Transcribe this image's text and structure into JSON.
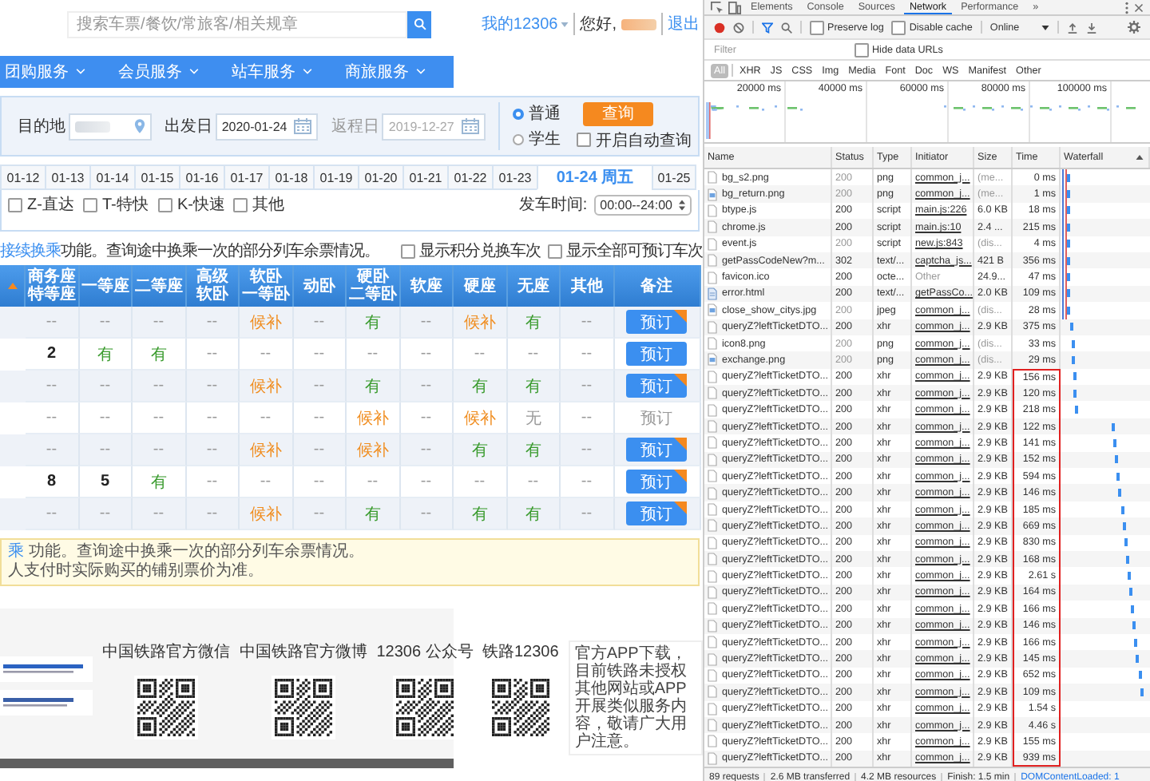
{
  "header": {
    "search_placeholder": "搜索车票/餐饮/常旅客/相关规章",
    "account_menu": "我的12306",
    "greeting": "您好,",
    "logout": "退出"
  },
  "nav": [
    {
      "label": "团购服务"
    },
    {
      "label": "会员服务"
    },
    {
      "label": "站车服务"
    },
    {
      "label": "商旅服务"
    }
  ],
  "search_form": {
    "destination_label": "目的地",
    "depart_label": "出发日",
    "depart_value": "2020-01-24",
    "return_label": "返程日",
    "return_value": "2019-12-27",
    "return_disabled": true,
    "ticket_types": [
      {
        "label": "普通",
        "selected": true
      },
      {
        "label": "学生",
        "selected": false
      }
    ],
    "query_button": "查询",
    "auto_query": {
      "label": "开启自动查询",
      "checked": false
    }
  },
  "date_tabs": [
    {
      "label": "01-12",
      "selected": false
    },
    {
      "label": "01-13",
      "selected": false
    },
    {
      "label": "01-14",
      "selected": false
    },
    {
      "label": "01-15",
      "selected": false
    },
    {
      "label": "01-16",
      "selected": false
    },
    {
      "label": "01-17",
      "selected": false
    },
    {
      "label": "01-18",
      "selected": false
    },
    {
      "label": "01-19",
      "selected": false
    },
    {
      "label": "01-20",
      "selected": false
    },
    {
      "label": "01-21",
      "selected": false
    },
    {
      "label": "01-22",
      "selected": false
    },
    {
      "label": "01-23",
      "selected": false
    },
    {
      "label": "01-24 周五",
      "selected": true
    },
    {
      "label": "01-25",
      "selected": false
    }
  ],
  "train_filters": [
    {
      "label": "Z-直达",
      "checked": false
    },
    {
      "label": "T-特快",
      "checked": false
    },
    {
      "label": "K-快速",
      "checked": false
    },
    {
      "label": "其他",
      "checked": false
    }
  ],
  "departure_time": {
    "label": "发车时间:",
    "value": "00:00--24:00"
  },
  "transfer_notice": {
    "link": "接续换乘",
    "text": "功能。查询途中换乘一次的部分列车余票情况。"
  },
  "display_options": [
    {
      "label": "显示积分兑换车次",
      "checked": false
    },
    {
      "label": "显示全部可预订车次",
      "checked": false
    }
  ],
  "table": {
    "columns": [
      {
        "label": "商务座",
        "sublabel": "特等座"
      },
      {
        "label": "一等座"
      },
      {
        "label": "二等座"
      },
      {
        "label": "高级",
        "sublabel": "软卧"
      },
      {
        "label": "软卧",
        "sublabel": "一等卧"
      },
      {
        "label": "动卧"
      },
      {
        "label": "硬卧",
        "sublabel": "二等卧"
      },
      {
        "label": "软座"
      },
      {
        "label": "硬座"
      },
      {
        "label": "无座"
      },
      {
        "label": "其他"
      },
      {
        "label": "备注"
      }
    ],
    "rows": [
      {
        "cells": [
          {
            "text": "--",
            "kind": "none"
          },
          {
            "text": "--",
            "kind": "none"
          },
          {
            "text": "--",
            "kind": "none"
          },
          {
            "text": "--",
            "kind": "none"
          },
          {
            "text": "候补",
            "kind": "waitlist"
          },
          {
            "text": "--",
            "kind": "none"
          },
          {
            "text": "有",
            "kind": "yes"
          },
          {
            "text": "--",
            "kind": "none"
          },
          {
            "text": "候补",
            "kind": "waitlist"
          },
          {
            "text": "有",
            "kind": "yes"
          },
          {
            "text": "--",
            "kind": "none"
          }
        ],
        "book": {
          "label": "预订",
          "disabled": false,
          "badge": true
        }
      },
      {
        "cells": [
          {
            "text": "2",
            "kind": "count"
          },
          {
            "text": "有",
            "kind": "yes"
          },
          {
            "text": "有",
            "kind": "yes"
          },
          {
            "text": "--",
            "kind": "none"
          },
          {
            "text": "--",
            "kind": "none"
          },
          {
            "text": "--",
            "kind": "none"
          },
          {
            "text": "--",
            "kind": "none"
          },
          {
            "text": "--",
            "kind": "none"
          },
          {
            "text": "--",
            "kind": "none"
          },
          {
            "text": "--",
            "kind": "none"
          },
          {
            "text": "--",
            "kind": "none"
          }
        ],
        "book": {
          "label": "预订",
          "disabled": false,
          "badge": false
        }
      },
      {
        "cells": [
          {
            "text": "--",
            "kind": "none"
          },
          {
            "text": "--",
            "kind": "none"
          },
          {
            "text": "--",
            "kind": "none"
          },
          {
            "text": "--",
            "kind": "none"
          },
          {
            "text": "候补",
            "kind": "waitlist"
          },
          {
            "text": "--",
            "kind": "none"
          },
          {
            "text": "有",
            "kind": "yes"
          },
          {
            "text": "--",
            "kind": "none"
          },
          {
            "text": "有",
            "kind": "yes"
          },
          {
            "text": "有",
            "kind": "yes"
          },
          {
            "text": "--",
            "kind": "none"
          }
        ],
        "book": {
          "label": "预订",
          "disabled": false,
          "badge": true
        }
      },
      {
        "cells": [
          {
            "text": "--",
            "kind": "none"
          },
          {
            "text": "--",
            "kind": "none"
          },
          {
            "text": "--",
            "kind": "none"
          },
          {
            "text": "--",
            "kind": "none"
          },
          {
            "text": "--",
            "kind": "none"
          },
          {
            "text": "--",
            "kind": "none"
          },
          {
            "text": "候补",
            "kind": "waitlist"
          },
          {
            "text": "--",
            "kind": "none"
          },
          {
            "text": "候补",
            "kind": "waitlist"
          },
          {
            "text": "无",
            "kind": "soldout"
          },
          {
            "text": "--",
            "kind": "none"
          }
        ],
        "book": {
          "label": "预订",
          "disabled": true,
          "badge": false
        }
      },
      {
        "cells": [
          {
            "text": "--",
            "kind": "none"
          },
          {
            "text": "--",
            "kind": "none"
          },
          {
            "text": "--",
            "kind": "none"
          },
          {
            "text": "--",
            "kind": "none"
          },
          {
            "text": "候补",
            "kind": "waitlist"
          },
          {
            "text": "--",
            "kind": "none"
          },
          {
            "text": "候补",
            "kind": "waitlist"
          },
          {
            "text": "--",
            "kind": "none"
          },
          {
            "text": "有",
            "kind": "yes"
          },
          {
            "text": "有",
            "kind": "yes"
          },
          {
            "text": "--",
            "kind": "none"
          }
        ],
        "book": {
          "label": "预订",
          "disabled": false,
          "badge": true
        }
      },
      {
        "cells": [
          {
            "text": "8",
            "kind": "count"
          },
          {
            "text": "5",
            "kind": "count"
          },
          {
            "text": "有",
            "kind": "yes"
          },
          {
            "text": "--",
            "kind": "none"
          },
          {
            "text": "--",
            "kind": "none"
          },
          {
            "text": "--",
            "kind": "none"
          },
          {
            "text": "--",
            "kind": "none"
          },
          {
            "text": "--",
            "kind": "none"
          },
          {
            "text": "--",
            "kind": "none"
          },
          {
            "text": "--",
            "kind": "none"
          },
          {
            "text": "--",
            "kind": "none"
          }
        ],
        "book": {
          "label": "预订",
          "disabled": false,
          "badge": true
        }
      },
      {
        "cells": [
          {
            "text": "--",
            "kind": "none"
          },
          {
            "text": "--",
            "kind": "none"
          },
          {
            "text": "--",
            "kind": "none"
          },
          {
            "text": "--",
            "kind": "none"
          },
          {
            "text": "候补",
            "kind": "waitlist"
          },
          {
            "text": "--",
            "kind": "none"
          },
          {
            "text": "有",
            "kind": "yes"
          },
          {
            "text": "--",
            "kind": "none"
          },
          {
            "text": "有",
            "kind": "yes"
          },
          {
            "text": "有",
            "kind": "yes"
          },
          {
            "text": "--",
            "kind": "none"
          }
        ],
        "book": {
          "label": "预订",
          "disabled": false,
          "badge": true
        }
      }
    ]
  },
  "notice": {
    "link": "乘",
    "lines": [
      " 功能。查询途中换乘一次的部分列车余票情况。",
      "人支付时实际购买的铺别票价为准。"
    ]
  },
  "footer": {
    "qr_codes": [
      {
        "title": "中国铁路官方微信"
      },
      {
        "title": "中国铁路官方微博"
      },
      {
        "title": "12306 公众号"
      },
      {
        "title": "铁路12306"
      }
    ],
    "app_notice": "官方APP下载，目前铁路未授权其他网站或APP开展类似服务内容，敬请广大用户注意。"
  },
  "devtools": {
    "tabs": [
      {
        "label": "Elements",
        "selected": false
      },
      {
        "label": "Console",
        "selected": false
      },
      {
        "label": "Sources",
        "selected": false
      },
      {
        "label": "Network",
        "selected": true
      },
      {
        "label": "Performance",
        "selected": false
      }
    ],
    "more_tabs": "»",
    "preserve_log": {
      "label": "Preserve log",
      "checked": false
    },
    "disable_cache": {
      "label": "Disable cache",
      "checked": false
    },
    "throttling": "Online",
    "filter_placeholder": "Filter",
    "hide_data_urls": {
      "label": "Hide data URLs",
      "checked": false
    },
    "type_filters": [
      {
        "label": "All",
        "selected": true
      },
      {
        "label": "XHR",
        "selected": false
      },
      {
        "label": "JS",
        "selected": false
      },
      {
        "label": "CSS",
        "selected": false
      },
      {
        "label": "Img",
        "selected": false
      },
      {
        "label": "Media",
        "selected": false
      },
      {
        "label": "Font",
        "selected": false
      },
      {
        "label": "Doc",
        "selected": false
      },
      {
        "label": "WS",
        "selected": false
      },
      {
        "label": "Manifest",
        "selected": false
      },
      {
        "label": "Other",
        "selected": false
      }
    ],
    "overview_ticks": [
      "20000 ms",
      "40000 ms",
      "60000 ms",
      "80000 ms",
      "100000 ms"
    ],
    "columns": [
      "Name",
      "Status",
      "Type",
      "Initiator",
      "Size",
      "Time",
      "Waterfall"
    ],
    "requests": [
      {
        "name": "bg_s2.png",
        "kind": "file",
        "status": "200",
        "type": "png",
        "initiator": "common_j...",
        "linked": true,
        "size": "(me...",
        "time": "0 ms",
        "cached": true,
        "marked": false
      },
      {
        "name": "bg_return.png",
        "kind": "image",
        "status": "200",
        "type": "png",
        "initiator": "common_j...",
        "linked": true,
        "size": "(me...",
        "time": "1 ms",
        "cached": true,
        "marked": false
      },
      {
        "name": "btype.js",
        "kind": "file",
        "status": "200",
        "type": "script",
        "initiator": "main.js:226",
        "linked": true,
        "size": "6.0 KB",
        "time": "18 ms",
        "cached": false,
        "marked": false
      },
      {
        "name": "chrome.js",
        "kind": "file",
        "status": "200",
        "type": "script",
        "initiator": "main.js:10",
        "linked": true,
        "size": "2.4 ...",
        "time": "215 ms",
        "cached": false,
        "marked": false
      },
      {
        "name": "event.js",
        "kind": "file",
        "status": "200",
        "type": "script",
        "initiator": "new.js:843",
        "linked": true,
        "size": "(dis...",
        "time": "4 ms",
        "cached": true,
        "marked": false
      },
      {
        "name": "getPassCodeNew?m...",
        "kind": "file",
        "status": "302",
        "type": "text/...",
        "initiator": "captcha_js...",
        "linked": true,
        "size": "421 B",
        "time": "356 ms",
        "cached": false,
        "marked": false
      },
      {
        "name": "favicon.ico",
        "kind": "file",
        "status": "200",
        "type": "octe...",
        "initiator": "Other",
        "linked": false,
        "size": "24.9...",
        "time": "47 ms",
        "cached": false,
        "marked": false
      },
      {
        "name": "error.html",
        "kind": "page",
        "status": "200",
        "type": "text/...",
        "initiator": "getPassCo...",
        "linked": true,
        "size": "2.0 KB",
        "time": "109 ms",
        "cached": false,
        "marked": false
      },
      {
        "name": "close_show_citys.jpg",
        "kind": "image",
        "status": "200",
        "type": "jpeg",
        "initiator": "common_j...",
        "linked": true,
        "size": "(dis...",
        "time": "28 ms",
        "cached": true,
        "marked": false
      },
      {
        "name": "queryZ?leftTicketDTO...",
        "kind": "file",
        "status": "200",
        "type": "xhr",
        "initiator": "common_j...",
        "linked": true,
        "size": "2.9 KB",
        "time": "375 ms",
        "cached": false,
        "marked": false
      },
      {
        "name": "icon8.png",
        "kind": "file",
        "status": "200",
        "type": "png",
        "initiator": "common_j...",
        "linked": true,
        "size": "(dis...",
        "time": "33 ms",
        "cached": true,
        "marked": false
      },
      {
        "name": "exchange.png",
        "kind": "image",
        "status": "200",
        "type": "png",
        "initiator": "common_j...",
        "linked": true,
        "size": "(dis...",
        "time": "29 ms",
        "cached": true,
        "marked": false
      },
      {
        "name": "queryZ?leftTicketDTO...",
        "kind": "file",
        "status": "200",
        "type": "xhr",
        "initiator": "common_j...",
        "linked": true,
        "size": "2.9 KB",
        "time": "156 ms",
        "cached": false,
        "marked": true
      },
      {
        "name": "queryZ?leftTicketDTO...",
        "kind": "file",
        "status": "200",
        "type": "xhr",
        "initiator": "common_j...",
        "linked": true,
        "size": "2.9 KB",
        "time": "120 ms",
        "cached": false,
        "marked": true
      },
      {
        "name": "queryZ?leftTicketDTO...",
        "kind": "file",
        "status": "200",
        "type": "xhr",
        "initiator": "common_j...",
        "linked": true,
        "size": "2.9 KB",
        "time": "218 ms",
        "cached": false,
        "marked": true
      },
      {
        "name": "queryZ?leftTicketDTO...",
        "kind": "file",
        "status": "200",
        "type": "xhr",
        "initiator": "common_j...",
        "linked": true,
        "size": "2.9 KB",
        "time": "122 ms",
        "cached": false,
        "marked": true
      },
      {
        "name": "queryZ?leftTicketDTO...",
        "kind": "file",
        "status": "200",
        "type": "xhr",
        "initiator": "common_j...",
        "linked": true,
        "size": "2.9 KB",
        "time": "141 ms",
        "cached": false,
        "marked": true
      },
      {
        "name": "queryZ?leftTicketDTO...",
        "kind": "file",
        "status": "200",
        "type": "xhr",
        "initiator": "common_j...",
        "linked": true,
        "size": "2.9 KB",
        "time": "152 ms",
        "cached": false,
        "marked": true
      },
      {
        "name": "queryZ?leftTicketDTO...",
        "kind": "file",
        "status": "200",
        "type": "xhr",
        "initiator": "common_j...",
        "linked": true,
        "size": "2.9 KB",
        "time": "594 ms",
        "cached": false,
        "marked": true
      },
      {
        "name": "queryZ?leftTicketDTO...",
        "kind": "file",
        "status": "200",
        "type": "xhr",
        "initiator": "common_j...",
        "linked": true,
        "size": "2.9 KB",
        "time": "146 ms",
        "cached": false,
        "marked": true
      },
      {
        "name": "queryZ?leftTicketDTO...",
        "kind": "file",
        "status": "200",
        "type": "xhr",
        "initiator": "common_j...",
        "linked": true,
        "size": "2.9 KB",
        "time": "185 ms",
        "cached": false,
        "marked": true
      },
      {
        "name": "queryZ?leftTicketDTO...",
        "kind": "file",
        "status": "200",
        "type": "xhr",
        "initiator": "common_j...",
        "linked": true,
        "size": "2.9 KB",
        "time": "669 ms",
        "cached": false,
        "marked": true
      },
      {
        "name": "queryZ?leftTicketDTO...",
        "kind": "file",
        "status": "200",
        "type": "xhr",
        "initiator": "common_j...",
        "linked": true,
        "size": "2.9 KB",
        "time": "830 ms",
        "cached": false,
        "marked": true
      },
      {
        "name": "queryZ?leftTicketDTO...",
        "kind": "file",
        "status": "200",
        "type": "xhr",
        "initiator": "common_j...",
        "linked": true,
        "size": "2.9 KB",
        "time": "168 ms",
        "cached": false,
        "marked": true
      },
      {
        "name": "queryZ?leftTicketDTO...",
        "kind": "file",
        "status": "200",
        "type": "xhr",
        "initiator": "common_j...",
        "linked": true,
        "size": "2.9 KB",
        "time": "2.61 s",
        "cached": false,
        "marked": true
      },
      {
        "name": "queryZ?leftTicketDTO...",
        "kind": "file",
        "status": "200",
        "type": "xhr",
        "initiator": "common_j...",
        "linked": true,
        "size": "2.9 KB",
        "time": "164 ms",
        "cached": false,
        "marked": true
      },
      {
        "name": "queryZ?leftTicketDTO...",
        "kind": "file",
        "status": "200",
        "type": "xhr",
        "initiator": "common_j...",
        "linked": true,
        "size": "2.9 KB",
        "time": "166 ms",
        "cached": false,
        "marked": true
      },
      {
        "name": "queryZ?leftTicketDTO...",
        "kind": "file",
        "status": "200",
        "type": "xhr",
        "initiator": "common_j...",
        "linked": true,
        "size": "2.9 KB",
        "time": "146 ms",
        "cached": false,
        "marked": true
      },
      {
        "name": "queryZ?leftTicketDTO...",
        "kind": "file",
        "status": "200",
        "type": "xhr",
        "initiator": "common_j...",
        "linked": true,
        "size": "2.9 KB",
        "time": "166 ms",
        "cached": false,
        "marked": true
      },
      {
        "name": "queryZ?leftTicketDTO...",
        "kind": "file",
        "status": "200",
        "type": "xhr",
        "initiator": "common_j...",
        "linked": true,
        "size": "2.9 KB",
        "time": "145 ms",
        "cached": false,
        "marked": true
      },
      {
        "name": "queryZ?leftTicketDTO...",
        "kind": "file",
        "status": "200",
        "type": "xhr",
        "initiator": "common_j...",
        "linked": true,
        "size": "2.9 KB",
        "time": "652 ms",
        "cached": false,
        "marked": true
      },
      {
        "name": "queryZ?leftTicketDTO...",
        "kind": "file",
        "status": "200",
        "type": "xhr",
        "initiator": "common_j...",
        "linked": true,
        "size": "2.9 KB",
        "time": "109 ms",
        "cached": false,
        "marked": true
      },
      {
        "name": "queryZ?leftTicketDTO...",
        "kind": "file",
        "status": "200",
        "type": "xhr",
        "initiator": "common_j...",
        "linked": true,
        "size": "2.9 KB",
        "time": "1.54 s",
        "cached": false,
        "marked": true
      },
      {
        "name": "queryZ?leftTicketDTO...",
        "kind": "file",
        "status": "200",
        "type": "xhr",
        "initiator": "common_j...",
        "linked": true,
        "size": "2.9 KB",
        "time": "4.46 s",
        "cached": false,
        "marked": true
      },
      {
        "name": "queryZ?leftTicketDTO...",
        "kind": "file",
        "status": "200",
        "type": "xhr",
        "initiator": "common_j...",
        "linked": true,
        "size": "2.9 KB",
        "time": "155 ms",
        "cached": false,
        "marked": true
      },
      {
        "name": "queryZ?leftTicketDTO...",
        "kind": "file",
        "status": "200",
        "type": "xhr",
        "initiator": "common_j...",
        "linked": true,
        "size": "2.9 KB",
        "time": "939 ms",
        "cached": false,
        "marked": true
      }
    ],
    "summary": [
      "89 requests",
      "2.6 MB transferred",
      "4.2 MB resources",
      "Finish: 1.5 min"
    ],
    "dom_loaded": "DOMContentLoaded: 1"
  }
}
